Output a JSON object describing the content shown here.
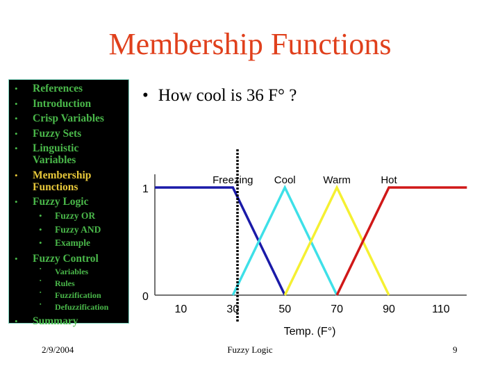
{
  "slide": {
    "title": "Membership Functions",
    "question_bullet": "•",
    "question": "How cool is 36 F° ?",
    "footer": {
      "date": "2/9/2004",
      "center": "Fuzzy Logic",
      "page": "9"
    }
  },
  "sidebar": {
    "items": [
      {
        "lines": [
          "References"
        ],
        "level": 1,
        "active": false
      },
      {
        "lines": [
          "Introduction"
        ],
        "level": 1,
        "active": false
      },
      {
        "lines": [
          "Crisp Variables"
        ],
        "level": 1,
        "active": false
      },
      {
        "lines": [
          "Fuzzy Sets"
        ],
        "level": 1,
        "active": false
      },
      {
        "lines": [
          "Linguistic",
          "Variables"
        ],
        "level": 1,
        "active": false
      },
      {
        "lines": [
          "Membership",
          "Functions"
        ],
        "level": 1,
        "active": true
      },
      {
        "lines": [
          "Fuzzy Logic"
        ],
        "level": 1,
        "active": false
      },
      {
        "lines": [
          "Fuzzy OR"
        ],
        "level": 2,
        "active": false
      },
      {
        "lines": [
          "Fuzzy AND"
        ],
        "level": 2,
        "active": false
      },
      {
        "lines": [
          "Example"
        ],
        "level": 2,
        "active": false
      },
      {
        "lines": [
          "Fuzzy Control"
        ],
        "level": 1,
        "active": false
      },
      {
        "lines": [
          "Variables"
        ],
        "level": 3,
        "active": false
      },
      {
        "lines": [
          "Rules"
        ],
        "level": 3,
        "active": false
      },
      {
        "lines": [
          "Fuzzification"
        ],
        "level": 3,
        "active": false
      },
      {
        "lines": [
          "Defuzzification"
        ],
        "level": 3,
        "active": false
      },
      {
        "lines": [
          "Summary"
        ],
        "level": 1,
        "active": false
      }
    ],
    "colors": {
      "normal": "#4ab84a",
      "active": "#e8c83a",
      "background": "#000000"
    }
  },
  "chart_data": {
    "type": "line",
    "title": "",
    "xlabel": "Temp. (F°)",
    "ylabel": "",
    "xlim": [
      0,
      120
    ],
    "ylim": [
      0,
      1
    ],
    "x_ticks": [
      10,
      30,
      50,
      70,
      90,
      110
    ],
    "y_ticks": [
      0,
      1
    ],
    "grid": false,
    "series": [
      {
        "name": "Freezing",
        "color": "#1a1aa8",
        "x": [
          0,
          30,
          50
        ],
        "y": [
          1,
          1,
          0
        ]
      },
      {
        "name": "Cool",
        "color": "#3ee0e8",
        "x": [
          30,
          50,
          70
        ],
        "y": [
          0,
          1,
          0
        ]
      },
      {
        "name": "Warm",
        "color": "#f5f032",
        "x": [
          50,
          70,
          90
        ],
        "y": [
          0,
          1,
          0
        ]
      },
      {
        "name": "Hot",
        "color": "#d01818",
        "x": [
          70,
          90,
          120
        ],
        "y": [
          0,
          1,
          1
        ]
      }
    ],
    "annotations": [
      {
        "type": "vertical-dashed-line",
        "x": 32,
        "color": "#000000"
      }
    ],
    "series_labels_position": "above-peaks"
  }
}
